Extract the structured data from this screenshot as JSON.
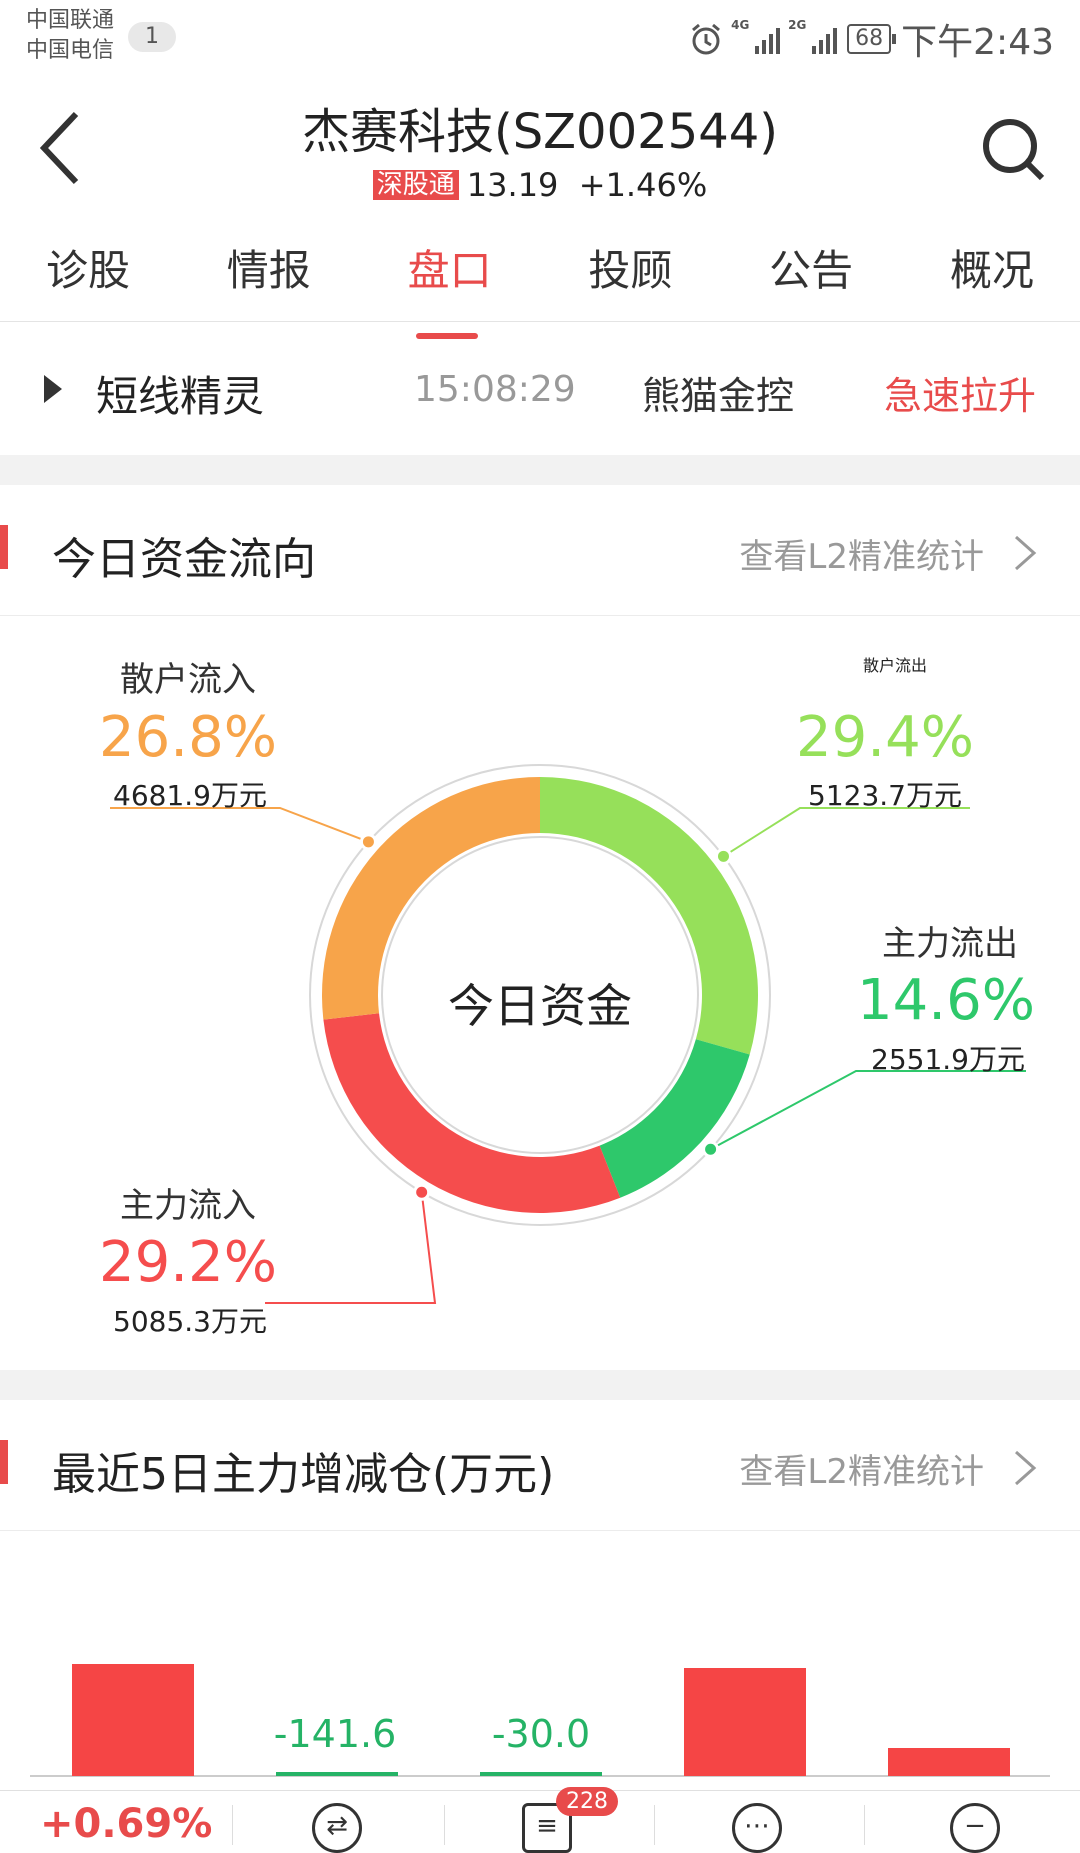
{
  "status_bar": {
    "carrier1": "中国联通",
    "carrier2": "中国电信",
    "sim_badge": "1",
    "net1": "4G",
    "net2": "2G",
    "battery": "68",
    "time": "下午2:43"
  },
  "header": {
    "title": "杰赛科技(SZ002544)",
    "tag": "深股通",
    "price": "13.19",
    "change": "+1.46%"
  },
  "tabs": [
    {
      "label": "诊股"
    },
    {
      "label": "情报"
    },
    {
      "label": "盘口",
      "active": true
    },
    {
      "label": "投顾"
    },
    {
      "label": "公告"
    },
    {
      "label": "概况"
    }
  ],
  "elf": {
    "name": "短线精灵",
    "time": "15:08:29",
    "company": "熊猫金控",
    "action": "急速拉升"
  },
  "fund_flow": {
    "title": "今日资金流向",
    "link": "查看L2精准统计",
    "center": "今日资金",
    "segments": [
      {
        "name": "散户流出",
        "pct": "29.4%",
        "amount": "5123.7万元",
        "value": 29.4,
        "color": "#96e05a"
      },
      {
        "name": "主力流出",
        "pct": "14.6%",
        "amount": "2551.9万元",
        "value": 14.6,
        "color": "#2ec86b"
      },
      {
        "name": "主力流入",
        "pct": "29.2%",
        "amount": "5085.3万元",
        "value": 29.2,
        "color": "#f54d4d"
      },
      {
        "name": "散户流入",
        "pct": "26.8%",
        "amount": "4681.9万元",
        "value": 26.8,
        "color": "#f7a44a"
      }
    ]
  },
  "five_day": {
    "title": "最近5日主力增减仓(万元)",
    "link": "查看L2精准统计",
    "bars": [
      {
        "sign": "pos",
        "label": ""
      },
      {
        "sign": "neg",
        "label": "-141.6",
        "value": -141.6
      },
      {
        "sign": "neg",
        "label": "-30.0",
        "value": -30.0
      },
      {
        "sign": "pos",
        "label": ""
      },
      {
        "sign": "pos",
        "label": ""
      }
    ]
  },
  "bottom_bar": {
    "change": "+0.69%",
    "badge": "228"
  }
}
